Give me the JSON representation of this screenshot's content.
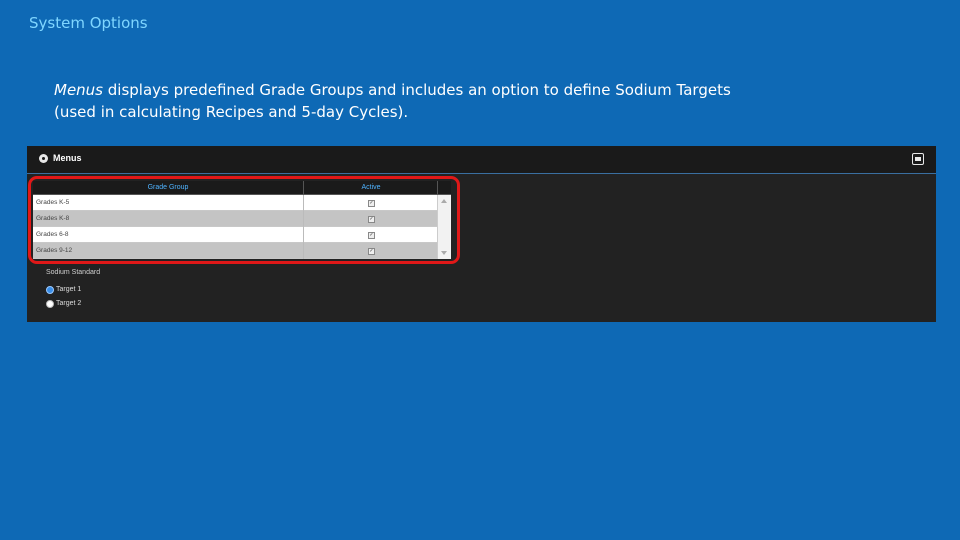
{
  "slide": {
    "title": "System Options",
    "description_lead": "Menus",
    "description_rest": " displays predefined Grade Groups and includes an option to define Sodium Targets (used in calculating Recipes and 5-day Cycles)."
  },
  "panel": {
    "title": "Menus",
    "icon": "gear-icon",
    "close_icon": "window-icon"
  },
  "grid": {
    "columns": [
      "Grade Group",
      "Active"
    ],
    "rows": [
      {
        "name": "Grades K-5",
        "active": true
      },
      {
        "name": "Grades K-8",
        "active": true
      },
      {
        "name": "Grades 6-8",
        "active": true
      },
      {
        "name": "Grades 9-12",
        "active": true
      }
    ]
  },
  "sodium": {
    "label": "Sodium Standard",
    "options": [
      {
        "label": "Target 1",
        "selected": true
      },
      {
        "label": "Target 2",
        "selected": false
      }
    ]
  },
  "colors": {
    "background": "#0e69b5",
    "highlight": "#e01818",
    "header_text": "#4fb3ff"
  }
}
